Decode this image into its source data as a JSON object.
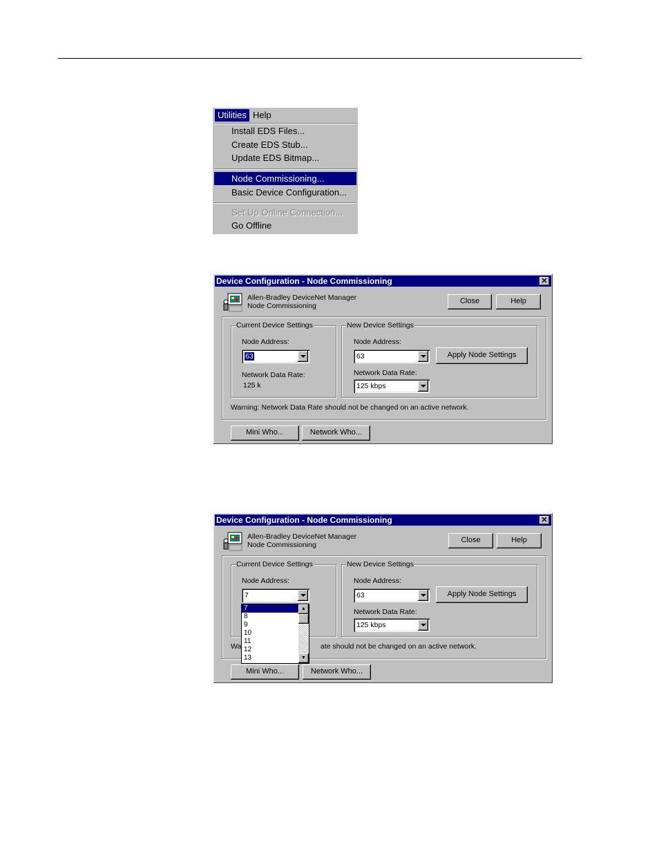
{
  "menu": {
    "titles": [
      "Utilities",
      "Help"
    ],
    "items": [
      {
        "label": "Install EDS Files...",
        "state": "normal"
      },
      {
        "label": "Create EDS Stub...",
        "state": "normal"
      },
      {
        "label": "Update EDS Bitmap...",
        "state": "normal"
      },
      {
        "label": "Node Commissioning...",
        "state": "selected"
      },
      {
        "label": "Basic Device Configuration...",
        "state": "normal"
      },
      {
        "label": "Set Up Online Connection...",
        "state": "disabled"
      },
      {
        "label": "Go Offline",
        "state": "normal"
      }
    ]
  },
  "dialog1": {
    "title": "Device Configuration - Node Commissioning",
    "app_name": "Allen-Bradley DeviceNet Manager",
    "app_sub": "Node Commissioning",
    "close_label": "Close",
    "help_label": "Help",
    "current": {
      "group_label": "Current Device Settings",
      "node_address_label": "Node Address:",
      "node_address_value": "63",
      "rate_label": "Network Data Rate:",
      "rate_value": "125 k"
    },
    "new": {
      "group_label": "New Device Settings",
      "node_address_label": "Node Address:",
      "node_address_value": "63",
      "rate_label": "Network Data Rate:",
      "rate_value": "125 kbps",
      "apply_label": "Apply Node Settings"
    },
    "warning": "Warning: Network Data Rate should not be changed on an active network.",
    "mini_who_label": "Mini Who...",
    "network_who_label": "Network Who..."
  },
  "dialog2": {
    "title": "Device Configuration - Node Commissioning",
    "app_name": "Allen-Bradley DeviceNet Manager",
    "app_sub": "Node Commissioning",
    "close_label": "Close",
    "help_label": "Help",
    "current": {
      "group_label": "Current Device Settings",
      "node_address_label": "Node Address:",
      "node_address_value": "7",
      "dropdown_options": [
        "7",
        "8",
        "9",
        "10",
        "11",
        "12",
        "13"
      ]
    },
    "new": {
      "group_label": "New Device Settings",
      "node_address_label": "Node Address:",
      "node_address_value": "63",
      "rate_label": "Network Data Rate:",
      "rate_value": "125 kbps",
      "apply_label": "Apply Node Settings"
    },
    "warning_prefix": "Wa",
    "warning_suffix": "ate should not be changed on an active network.",
    "mini_who_label": "Mini Who...",
    "network_who_label": "Network Who..."
  }
}
